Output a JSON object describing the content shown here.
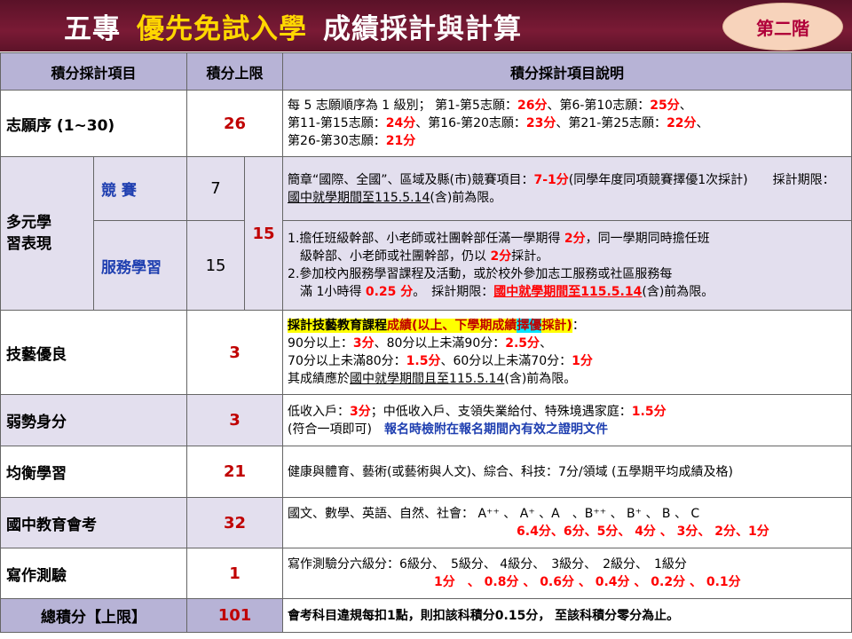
{
  "header": {
    "title_a": "五專",
    "title_b": "優先免試入學",
    "title_c": "成績採計與計算",
    "badge": "第二階"
  },
  "table": {
    "col1": "積分採計項目",
    "col2": "積分上限",
    "col3": "積分採計項目說明"
  },
  "rows": {
    "zhiyuan": {
      "name": "志願序 (1~30)",
      "max": "26",
      "d1": "每 5 志願順序為 1 級別； 第1-第5志願：",
      "d1v": "26分",
      "d2": "、第6-第10志願：",
      "d2v": "25分",
      "d3": "、",
      "d4": "第11-第15志願：",
      "d4v": "24分",
      "d5": "、第16-第20志願：",
      "d5v": "23分",
      "d6": "、第21-第25志願：",
      "d6v": "22分",
      "d7": "、",
      "d8": "第26-第30志願：",
      "d8v": "21分"
    },
    "duoyuan": {
      "name": "多元學習表現",
      "group_max": "15",
      "contest": {
        "name": "競 賽",
        "max": "7",
        "d1": "簡章“國際、全國”、區域及縣(市)競賽項目：",
        "d1v": "7-1分",
        "d2": "(同學年度同項競賽擇優1次採計)　　採計期限：",
        "d3": "國中就學期間至115.5.14",
        "d4": "(含)前為限。"
      },
      "service": {
        "name": "服務學習",
        "max": "15",
        "l1a": "1.擔任班級幹部、小老師或社團幹部任滿一學期得 ",
        "l1v": "2分",
        "l1b": "，同一學期同時擔任班",
        "l2a": "級幹部、小老師或社團幹部，仍以 ",
        "l2v": "2分",
        "l2b": "採計。",
        "l3": "2.參加校內服務學習課程及活動，或於校外參加志工服務或社區服務每",
        "l4a": "滿 1小時得 ",
        "l4v": "0.25 分",
        "l4b": "。　採計期限：",
        "l4c": "國中就學期間至115.5.14",
        "l4d": "(含)前為限。"
      }
    },
    "jiyi": {
      "name": "技藝優良",
      "max": "3",
      "hl1": "採計技藝教育課程",
      "hl2": "成績(以上、下學期成績",
      "hl3": "擇優",
      "hl4": "採計)",
      "hl5": "：",
      "l2a": "90分以上：",
      "l2v": "3分",
      "l2b": "、80分以上未滿90分：",
      "l2v2": "2.5分",
      "l2c": "、",
      "l3a": "70分以上未滿80分：",
      "l3v": "1.5分",
      "l3b": "、60分以上未滿70分：",
      "l3v2": "1分",
      "l4a": "其成績應於",
      "l4b": "國中就學期間",
      "l4c": "且至115.5.14",
      "l4d": "(含)前為限。"
    },
    "ruoshi": {
      "name": "弱勢身分",
      "max": "3",
      "l1a": "低收入戶：",
      "l1v": "3分",
      "l1b": "；中低收入戶、支領失業給付、特殊境遇家庭：",
      "l1v2": "1.5分",
      "l2a": "(符合一項即可)　",
      "l2b": "報名時檢附在報名期間內有效之證明文件"
    },
    "junheng": {
      "name": "均衡學習",
      "max": "21",
      "desc": "健康與體育、藝術(或藝術與人文)、綜合、科技：7分/領域  (五學期平均成績及格)"
    },
    "huikao": {
      "name": "國中教育會考",
      "max": "32",
      "l1": "國文、數學、英語、自然、社會： A⁺⁺ 、 A⁺ 、A　、B⁺⁺ 、 B⁺ 、 B 、 C",
      "l2": "6.4分、6分、5分、 4分 、 3分、 2分、1分"
    },
    "xiezuo": {
      "name": "寫作測驗",
      "max": "1",
      "l1": "寫作測驗分六級分：6級分、　5級分、 4級分、　3級分、　2級分、　1級分",
      "l2": "1分　、 0.8分 、 0.6分 、 0.4分 、 0.2分 、 0.1分"
    },
    "total": {
      "name": "總積分【上限】",
      "max": "101",
      "desc": "會考科目違規每扣1點，則扣該科積分0.15分，  至該科積分零分為止。"
    }
  }
}
